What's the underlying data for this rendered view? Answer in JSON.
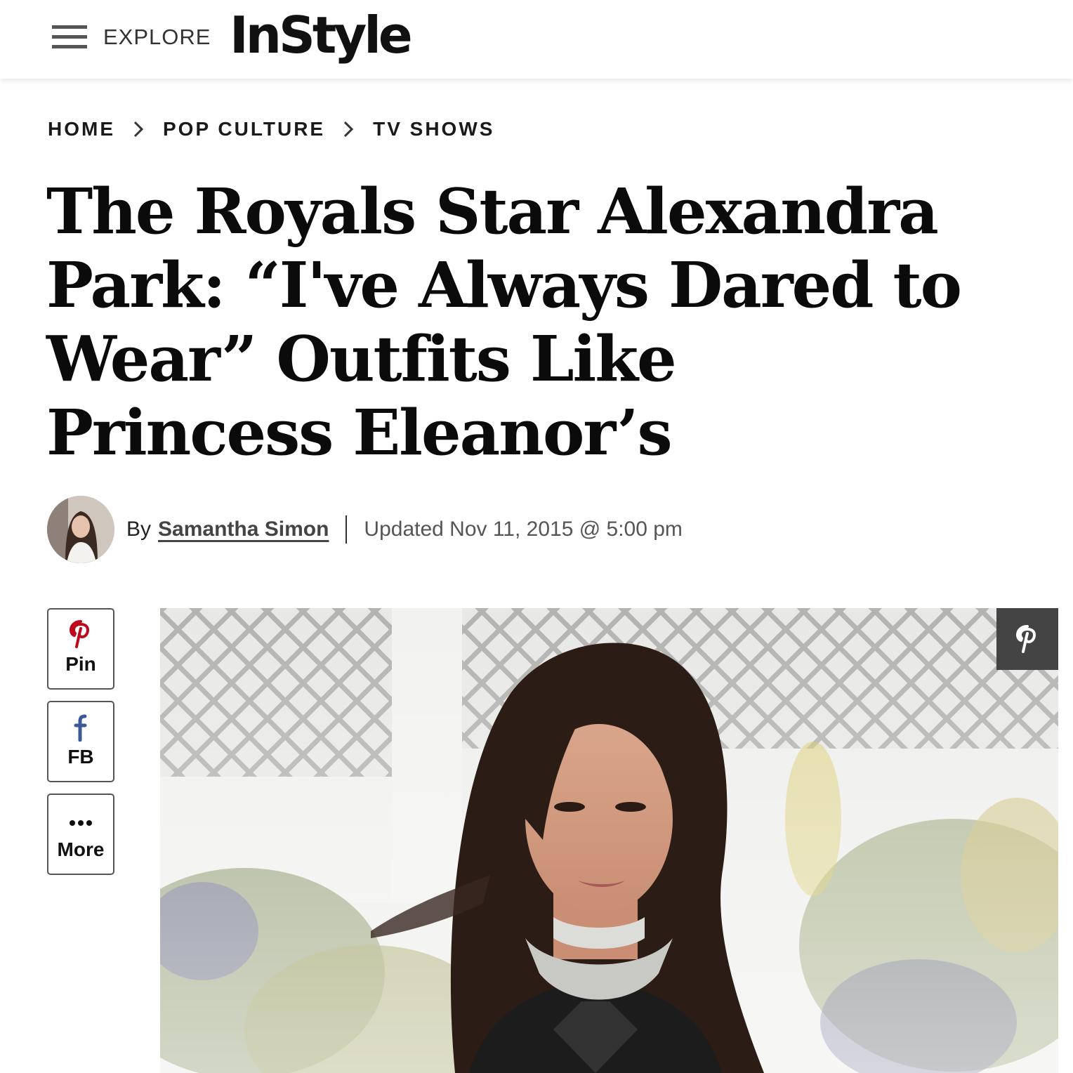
{
  "header": {
    "explore_label": "EXPLORE",
    "logo_text": "InStyle"
  },
  "breadcrumb": {
    "items": [
      "HOME",
      "POP CULTURE",
      "TV SHOWS"
    ]
  },
  "article": {
    "title": "The Royals Star Alexandra Park: “I've Always Dared to Wear” Outfits Like Princess Eleanor’s",
    "byline_prefix": "By",
    "author": "Samantha Simon",
    "updated": "Updated Nov 11, 2015 @ 5:00 pm"
  },
  "share": {
    "pin_label": "Pin",
    "fb_label": "FB",
    "more_label": "More"
  },
  "colors": {
    "pinterest_red": "#bd081c",
    "facebook_blue": "#3b5998",
    "overlay_gray": "#444444"
  },
  "icons": {
    "menu": "hamburger-menu-icon",
    "breadcrumb_separator": "chevron-right-icon",
    "pin": "pinterest-icon",
    "fb": "facebook-icon",
    "more": "more-dots-icon",
    "hero_pin": "pinterest-icon"
  }
}
